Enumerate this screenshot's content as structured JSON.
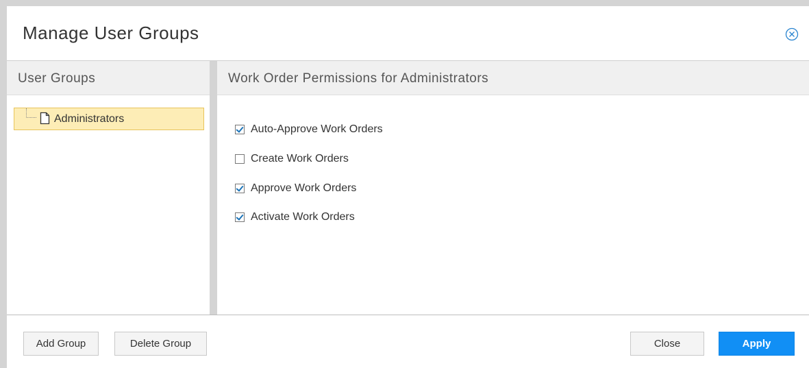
{
  "dialog": {
    "title": "Manage User Groups"
  },
  "left_panel": {
    "header": "User Groups",
    "groups": [
      {
        "label": "Administrators",
        "selected": true
      }
    ]
  },
  "right_panel": {
    "header": "Work Order Permissions for Administrators",
    "permissions": [
      {
        "label": "Auto-Approve Work Orders",
        "checked": true
      },
      {
        "label": "Create Work Orders",
        "checked": false
      },
      {
        "label": "Approve Work Orders",
        "checked": true
      },
      {
        "label": "Activate Work Orders",
        "checked": true
      }
    ]
  },
  "footer": {
    "add_group_label": "Add Group",
    "delete_group_label": "Delete Group",
    "close_label": "Close",
    "apply_label": "Apply"
  },
  "colors": {
    "accent": "#118ff5",
    "selection_bg": "#fdedb6",
    "selection_border": "#e8c45a",
    "checkbox_check": "#1a73b8"
  },
  "icons": {
    "close": "close-circle-icon",
    "tree_item": "document-icon"
  }
}
